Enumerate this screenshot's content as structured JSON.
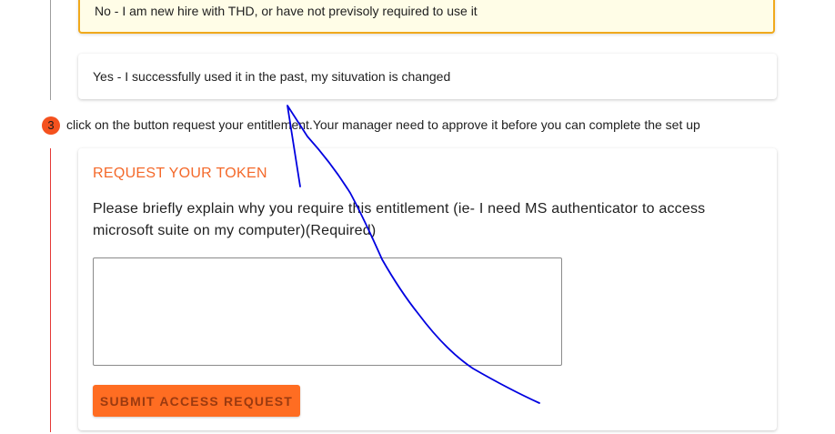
{
  "options": {
    "no_option": "No - I am new hire with THD, or have not previsoly required to use it",
    "yes_option": "Yes - I successfully used it in the past, my situvation is changed"
  },
  "step": {
    "number": "3",
    "text": "click on the button request your entitlement.Your manager need to approve it before you can complete the set up"
  },
  "request": {
    "title": "REQUEST YOUR TOKEN",
    "prompt": "Please briefly explain why you require this entitlement (ie- I need MS authenticator to access microsoft suite on my computer)(Required)",
    "textarea_value": "",
    "submit_label": "SUBMIT ACCESS REQUEST"
  },
  "colors": {
    "accent": "#ff6d22",
    "title": "#f4692a",
    "selected_border": "#f0a91c",
    "step_badge": "#f4511e",
    "rail_active": "#e53935",
    "annotation_ink": "#0000e0"
  }
}
